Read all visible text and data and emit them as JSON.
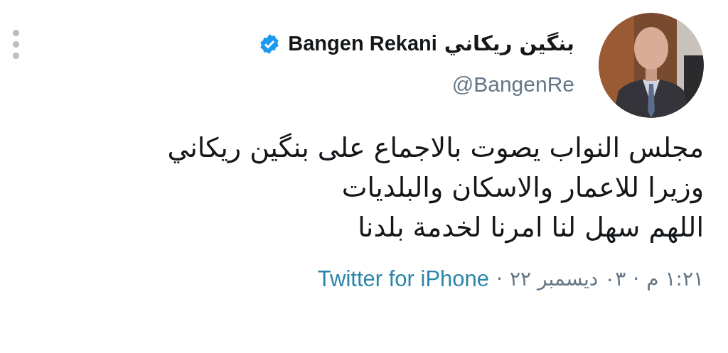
{
  "author": {
    "name_arabic": "بنگين ريكاني",
    "name_latin": "Bangen Rekani",
    "verified": true,
    "handle": "@BangenRe"
  },
  "tweet": {
    "lines": [
      "مجلس النواب يصوت بالاجماع على بنگين ريكاني",
      "وزيرا للاعمار والاسكان والبلديات",
      "اللهم سهل لنا امرنا لخدمة بلدنا"
    ]
  },
  "footer": {
    "time": "١:٢١ م",
    "date": "٠٣ ديسمبر ٢٢",
    "separator": "·",
    "source": "Twitter for iPhone"
  }
}
